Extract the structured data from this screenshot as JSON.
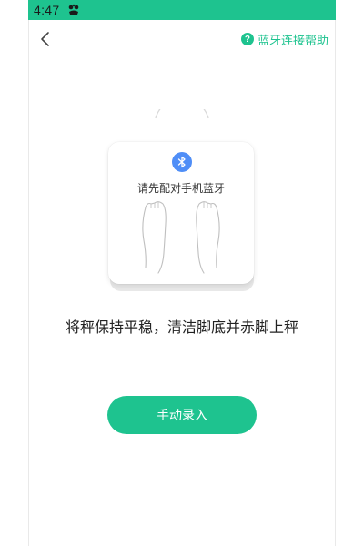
{
  "status_bar": {
    "time": "4:47",
    "app_icon": "app-notification-icon",
    "color": "#1ec38f"
  },
  "header": {
    "back_icon": "chevron-left-icon",
    "help_icon": "question-circle-icon",
    "help_label": "蓝牙连接帮助",
    "help_color": "#1ec38f"
  },
  "scale_card": {
    "bluetooth_icon": "bluetooth-icon",
    "bluetooth_color": "#4f8ef7",
    "prompt": "请先配对手机蓝牙",
    "feet_icon": "bare-feet-icon"
  },
  "instruction": "将秤保持平稳，清洁脚底并赤脚上秤",
  "actions": {
    "manual_entry_label": "手动录入",
    "accent": "#1ec38f"
  }
}
